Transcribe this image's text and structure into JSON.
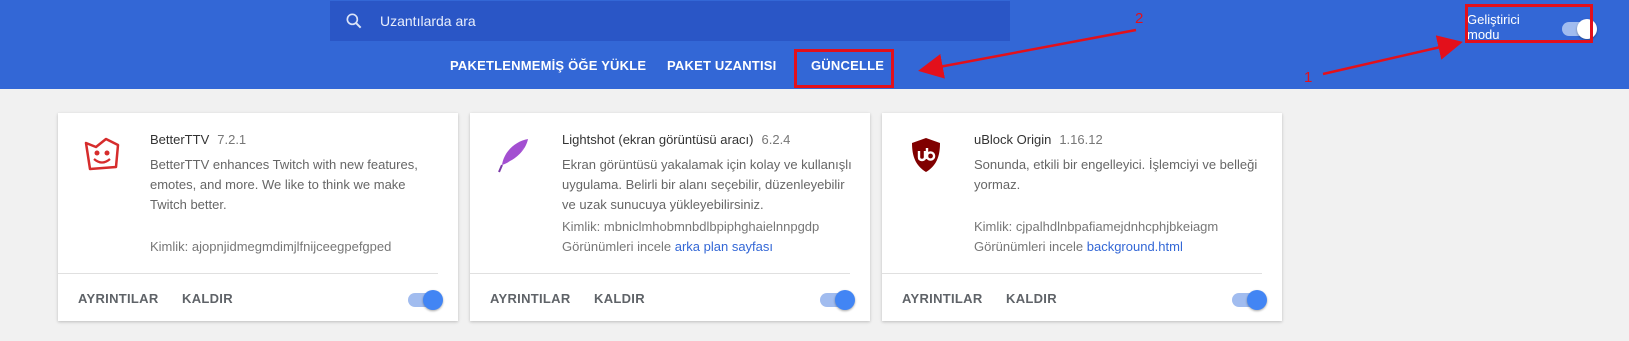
{
  "search": {
    "placeholder": "Uzantılarda ara"
  },
  "toolbar": {
    "load_unpacked": "PAKETLENMEMİŞ ÖĞE YÜKLE",
    "pack_extension": "PAKET UZANTISI",
    "update": "GÜNCELLE"
  },
  "dev_mode": {
    "label": "Geliştirici modu",
    "enabled": true
  },
  "annotations": {
    "one": "1",
    "two": "2",
    "color": "#e3101b"
  },
  "colors": {
    "header": "#3367d6",
    "search_bg": "#2a56c6",
    "toggle_on": "#4285f4",
    "link": "#3367d6"
  },
  "extensions": [
    {
      "name": "BetterTTV",
      "version": "7.2.1",
      "description": "BetterTTV enhances Twitch with new features, emotes, and more. We like to think we make Twitch better.",
      "id_label": "Kimlik: ajopnjidmegmdimjlfnijceegpefgped",
      "inspect_label": "",
      "inspect_link": "",
      "details": "AYRINTILAR",
      "remove": "KALDIR",
      "enabled": true,
      "icon": "betterttv-icon"
    },
    {
      "name": "Lightshot (ekran görüntüsü aracı)",
      "version": "6.2.4",
      "description": "Ekran görüntüsü yakalamak için kolay ve kullanışlı uygulama. Belirli bir alanı seçebilir, düzenleyebilir ve uzak sunucuya yükleyebilirsiniz.",
      "id_label": "Kimlik: mbniclmhobmnbdlbpiphghaielnnpgdp",
      "inspect_label": "Görünümleri incele",
      "inspect_link": "arka plan sayfası",
      "details": "AYRINTILAR",
      "remove": "KALDIR",
      "enabled": true,
      "icon": "lightshot-feather-icon"
    },
    {
      "name": "uBlock Origin",
      "version": "1.16.12",
      "description": "Sonunda, etkili bir engelleyici. İşlemciyi ve belleği yormaz.",
      "id_label": "Kimlik: cjpalhdlnbpafiamejdnhcphjbkeiagm",
      "inspect_label": "Görünümleri incele",
      "inspect_link": "background.html",
      "details": "AYRINTILAR",
      "remove": "KALDIR",
      "enabled": true,
      "icon": "ublock-shield-icon"
    }
  ]
}
